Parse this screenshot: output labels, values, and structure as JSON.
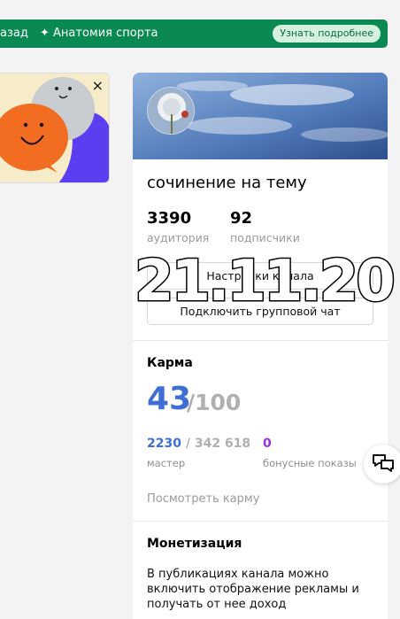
{
  "topbar": {
    "back_label": "азад",
    "promo_label": "✦ Анатомия спорта",
    "learn_more_label": "Узнать подробнее"
  },
  "ad": {
    "close_glyph": "×"
  },
  "channel": {
    "title": "сочинение на тему",
    "audience_value": "3390",
    "audience_label": "аудитория",
    "subscribers_value": "92",
    "subscribers_label": "подписчики",
    "settings_button": "Настройки канала",
    "group_chat_button": "Подключить групповой чат"
  },
  "karma": {
    "heading": "Карма",
    "value": "43",
    "max": "/100",
    "rank_current": "2230",
    "rank_total": " / 342 618",
    "rank_label": "мастер",
    "bonus_value": "0",
    "bonus_label": "бонусные показы",
    "view_link": "Посмотреть карму"
  },
  "monetization": {
    "heading": "Монетизация",
    "text": "В публикациях канала можно включить отображение рекламы и получать от нее доход"
  },
  "overlay": {
    "date": "21.11.20"
  },
  "icons": {
    "chat": "chat-bubbles-icon",
    "close": "close-icon"
  },
  "colors": {
    "topbar": "#0a8a52",
    "karma_blue": "#3f6fd4",
    "bonus_purple": "#9b32d8"
  }
}
